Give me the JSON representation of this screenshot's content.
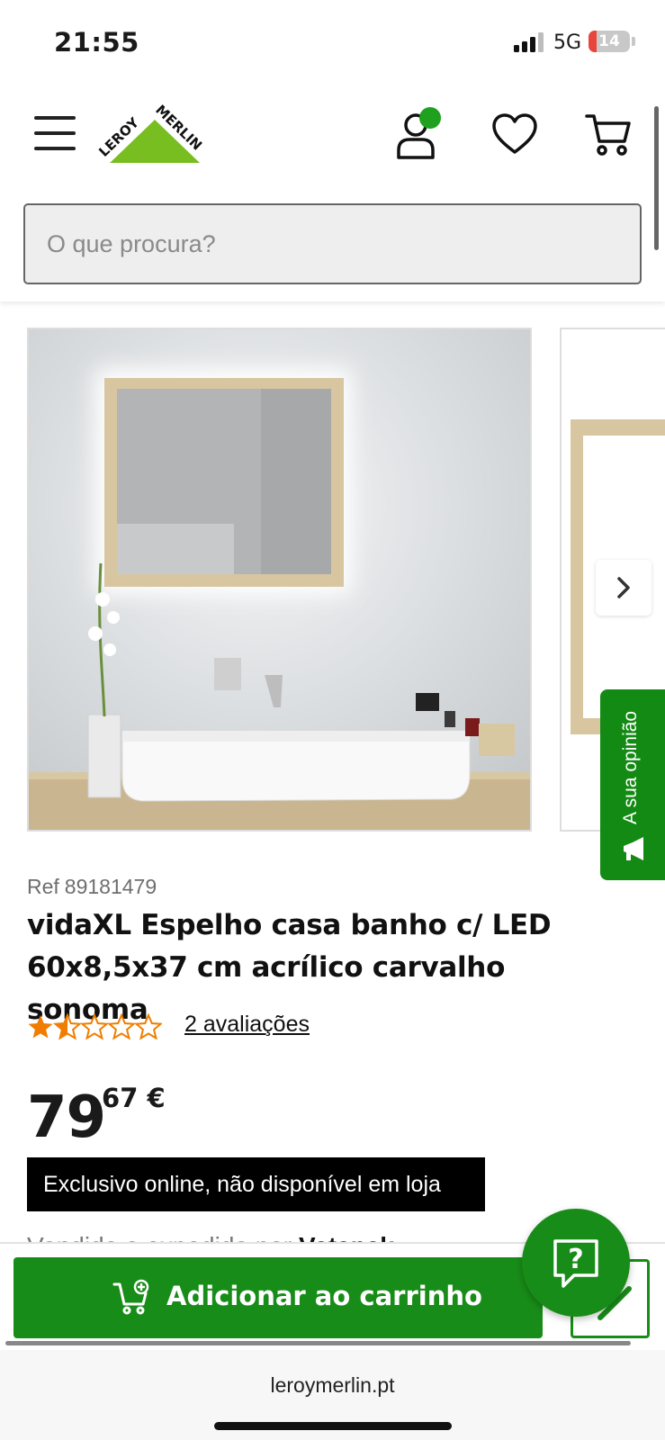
{
  "status_bar": {
    "time": "21:55",
    "network": "5G",
    "battery_level": "14",
    "battery_color": "#e8453c"
  },
  "header": {
    "brand": "LEROY MERLIN",
    "brand_color": "#78be20",
    "icons": [
      "menu-icon",
      "account-icon",
      "heart-icon",
      "cart-icon"
    ],
    "account_badge_color": "#1fa01f"
  },
  "search": {
    "placeholder": "O que procura?"
  },
  "product": {
    "ref_label": "Ref",
    "ref_number": "89181479",
    "title": "vidaXL Espelho casa banho c/ LED 60x8,5x37 cm acrílico carvalho sonoma",
    "rating": 1.5,
    "rating_max": 5,
    "reviews_label": "2 avaliações",
    "price_int": "79",
    "price_dec": ",67 €",
    "badge": "Exclusivo online, não disponível em loja",
    "seller_prefix": "Vendido e expedido por",
    "seller_name": "Vatapak"
  },
  "feedback": {
    "label": "A sua opinião"
  },
  "actions": {
    "add_to_cart": "Adicionar ao carrinho",
    "primary_color": "#188c18"
  },
  "browser": {
    "url": "leroymerlin.pt"
  }
}
